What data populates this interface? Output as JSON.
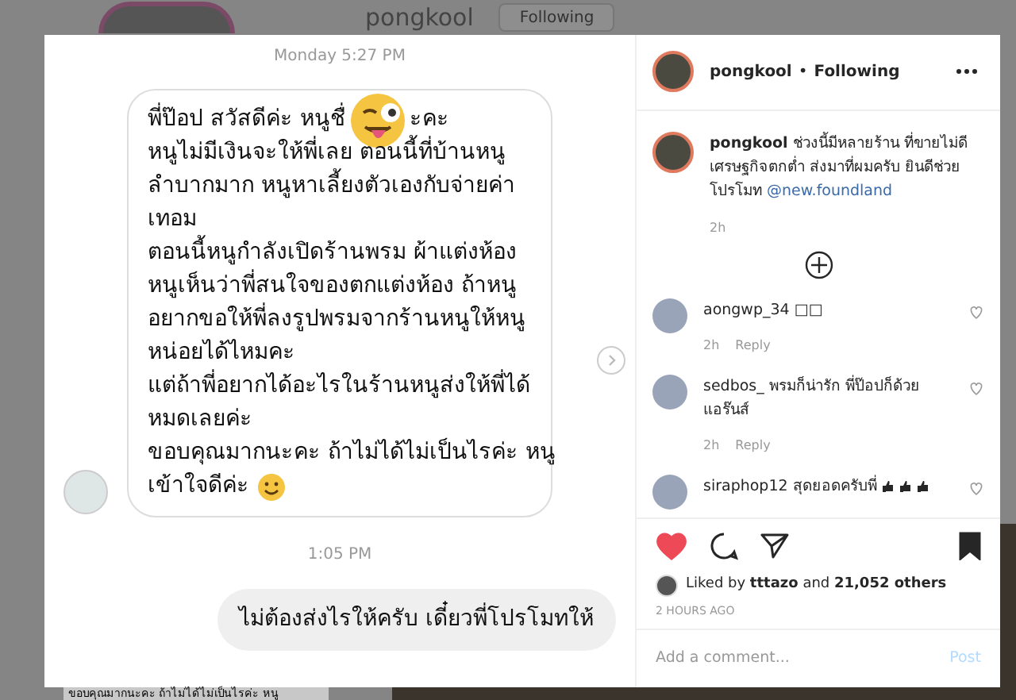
{
  "background_page": {
    "username": "pongkool",
    "follow_button": "Following",
    "snippet": "ขอบคุณมากนะคะ ถ้าไม่ได้ไม่เป็นไรค่ะ หนู"
  },
  "chat": {
    "timestamp_1": "Monday 5:27 PM",
    "received_lines": [
      {
        "kind": "covered",
        "before": "พี่ป๊อป สวัสดีค่ะ หนูชื่",
        "after": "ะคะ"
      },
      {
        "kind": "plain",
        "text": "หนูไม่มีเงินจะให้พี่เลย ตอนนี้ที่บ้านหนู"
      },
      {
        "kind": "plain",
        "text": "ลำบากมาก หนูหาเลี้ยงตัวเองกับจ่ายค่า"
      },
      {
        "kind": "plain",
        "text": "เทอม"
      },
      {
        "kind": "plain",
        "text": "ตอนนี้หนูกำลังเปิดร้านพรม ผ้าแต่งห้อง"
      },
      {
        "kind": "plain",
        "text": "หนูเห็นว่าพี่สนใจของตกแต่งห้อง ถ้าหนู"
      },
      {
        "kind": "plain",
        "text": "อยากขอให้พี่ลงรูปพรมจากร้านหนูให้หนู"
      },
      {
        "kind": "plain",
        "text": "หน่อยได้ไหมคะ"
      },
      {
        "kind": "plain",
        "text": "แต่ถ้าพี่อยากได้อะไรในร้านหนูส่งให้พี่ได้"
      },
      {
        "kind": "plain",
        "text": "หมดเลยค่ะ"
      },
      {
        "kind": "plain",
        "text": "ขอบคุณมากนะคะ ถ้าไม่ได้ไม่เป็นไรค่ะ หนู"
      },
      {
        "kind": "smiley",
        "text": "เข้าใจดีค่ะ"
      }
    ],
    "timestamp_2": "1:05 PM",
    "sent_message": "ไม่ต้องส่งไรให้ครับ เดี๋ยวพี่โปรโมทให้"
  },
  "post": {
    "header": {
      "username": "pongkool",
      "separator": "•",
      "follow_status": "Following"
    },
    "caption": {
      "username": "pongkool",
      "text": "ช่วงนี้มีหลายร้าน ที่ขายไม่ดี เศรษฐกิจตกต่ำ ส่งมาที่ผมครับ ยินดีช่วยโปรโมท",
      "mention": "@new.foundland",
      "time": "2h"
    },
    "comments": [
      {
        "username": "aongwp_34",
        "text": "□□",
        "time": "2h",
        "reply": "Reply",
        "kind": "plain",
        "liked": false
      },
      {
        "username": "sedbos_",
        "text": "พรมก็น่ารัก พี่ป๊อปก็ด้วย แอร๊นส์",
        "time": "2h",
        "reply": "Reply",
        "kind": "plain",
        "liked": false
      },
      {
        "username": "siraphop12",
        "text": "สุดยอดครับพี่",
        "kind": "thumbs",
        "liked": false
      }
    ],
    "liked": true,
    "saved": true,
    "likes": "Liked by **tttazo** and **21,052 others**",
    "posted": "2 HOURS AGO",
    "comment_field": {
      "placeholder": "Add a comment..."
    },
    "post_button": "Post"
  }
}
